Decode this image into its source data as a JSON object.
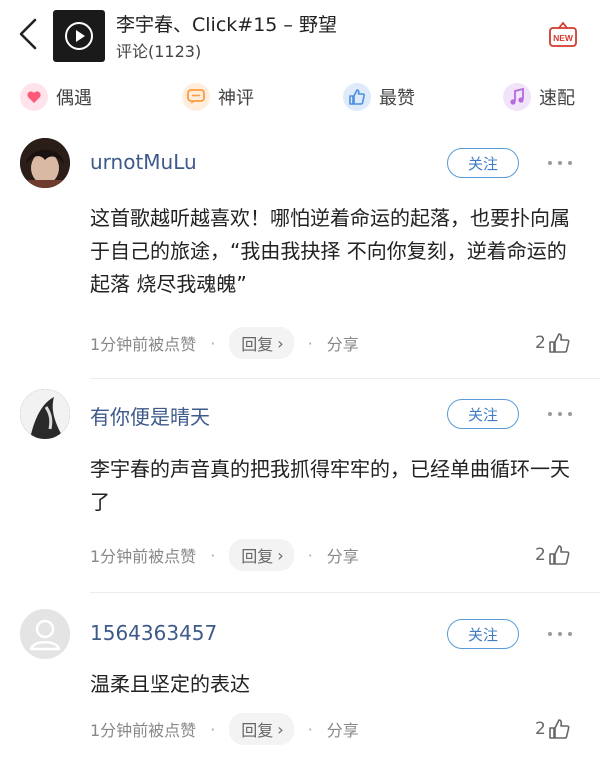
{
  "header": {
    "song_title": "李宇春、Click#15 – 野望",
    "comment_count": "评论(1123)",
    "new_label": "NEW"
  },
  "filters": [
    {
      "label": "偶遇",
      "icon": "heart-icon",
      "color": "#ff5a7a"
    },
    {
      "label": "神评",
      "icon": "chat-bubble-icon",
      "color": "#ff9a3d"
    },
    {
      "label": "最赞",
      "icon": "thumb-up-icon",
      "color": "#4a90e2"
    },
    {
      "label": "速配",
      "icon": "music-note-icon",
      "color": "#b36bdc"
    }
  ],
  "comments": [
    {
      "user": "urnotMuLu",
      "follow": "关注",
      "content": "这首歌越听越喜欢！哪怕逆着命运的起落，也要扑向属于自己的旅途，“我由我抉择 不向你复刻，逆着命运的起落 烧尽我魂魄”",
      "time": "1分钟前被点赞",
      "reply": "回复",
      "share": "分享",
      "likes": "2"
    },
    {
      "user": "有你便是晴天",
      "follow": "关注",
      "content": "李宇春的声音真的把我抓得牢牢的，已经单曲循环一天了",
      "time": "1分钟前被点赞",
      "reply": "回复",
      "share": "分享",
      "likes": "2"
    },
    {
      "user": "1564363457",
      "follow": "关注",
      "content": "温柔且坚定的表达",
      "time": "1分钟前被点赞",
      "reply": "回复",
      "share": "分享",
      "likes": "2"
    }
  ]
}
